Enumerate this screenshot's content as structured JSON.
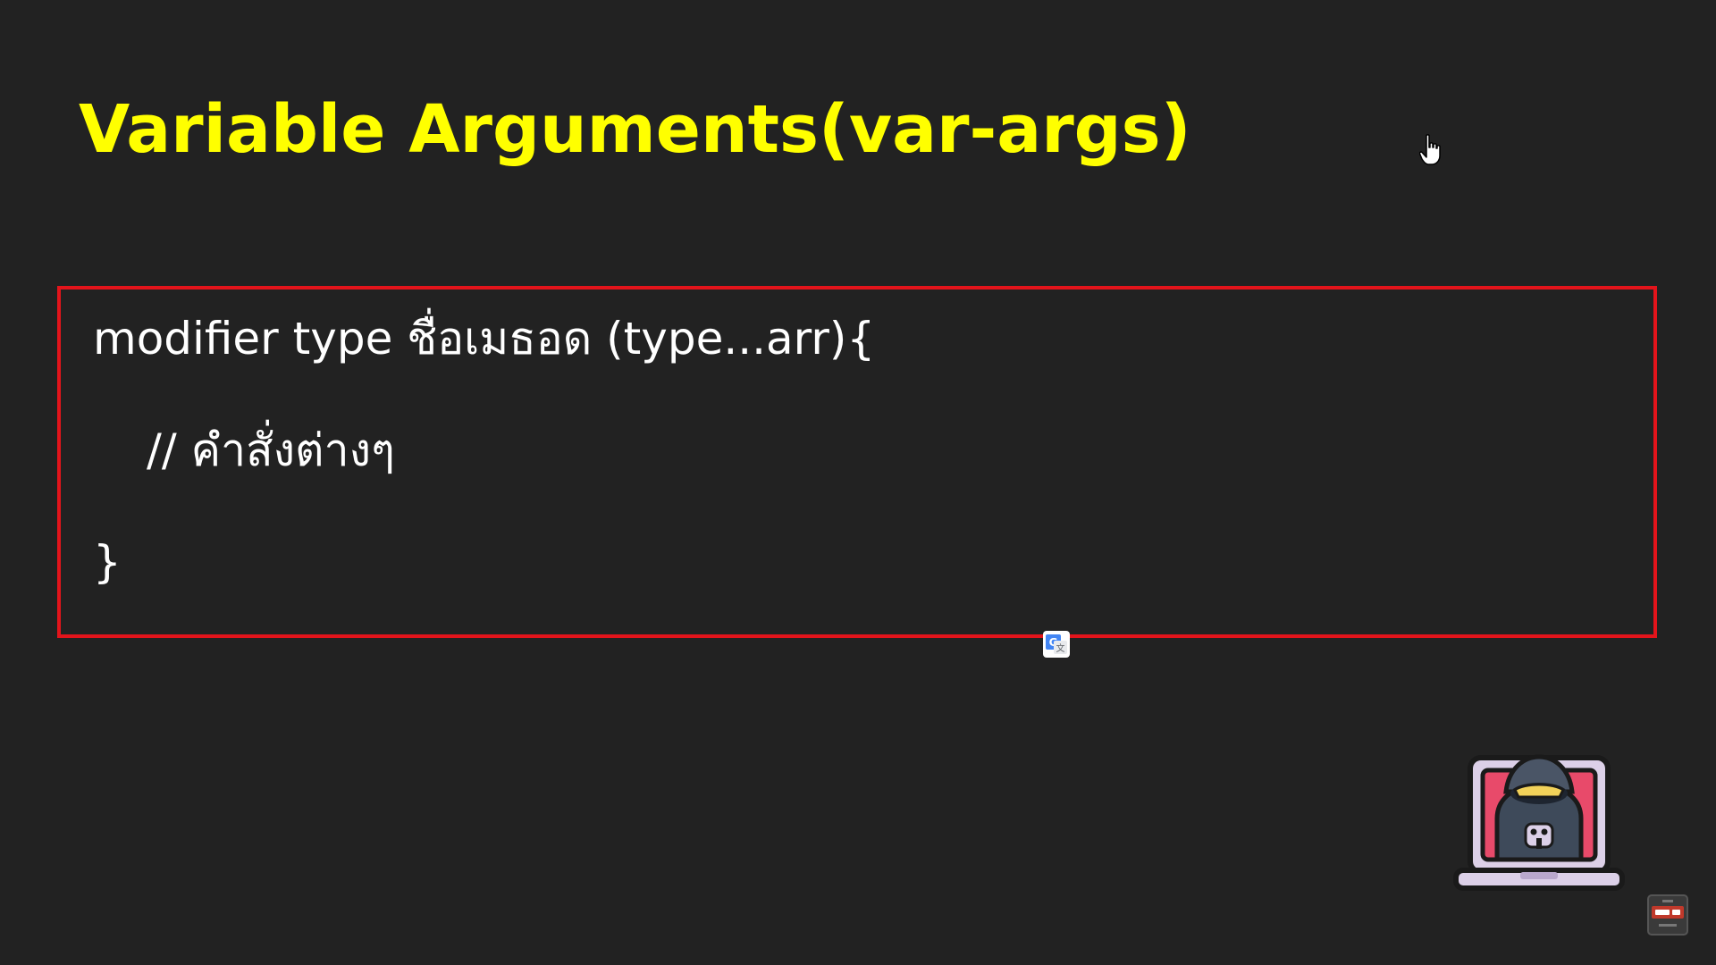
{
  "slide": {
    "title": "Variable Arguments(var-args)",
    "code": {
      "line1": "modifier type ชื่อเมธอด (type...arr){",
      "line2": "// คำสั่งต่างๆ",
      "line3": "}"
    }
  },
  "icons": {
    "cursor": "hand-pointer-icon",
    "translate": "google-translate-icon",
    "logo": "hacker-laptop-logo",
    "watermark": "subscribe-watermark-icon"
  },
  "colors": {
    "background": "#222222",
    "title": "#ffff00",
    "box_border": "#e3141b",
    "code_text": "#ffffff"
  }
}
